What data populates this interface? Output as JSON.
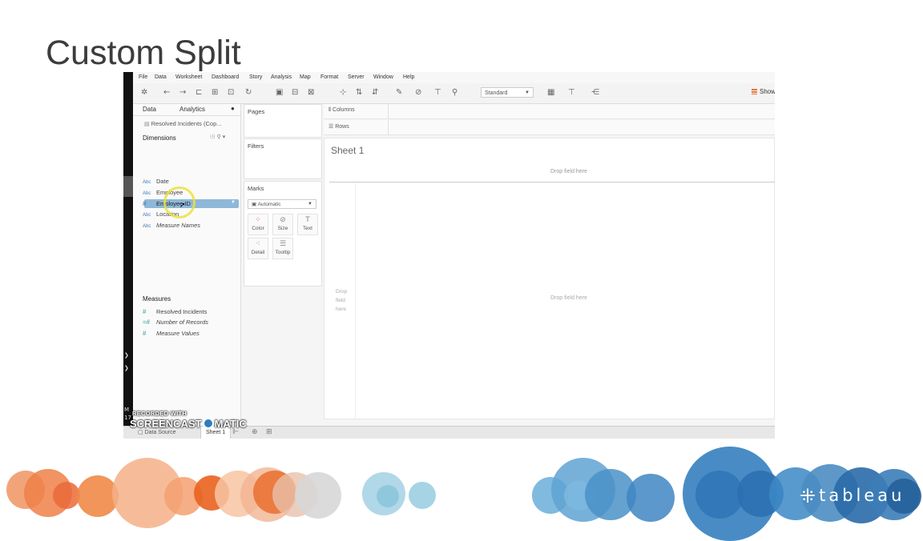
{
  "slide": {
    "title": "Custom Split",
    "logo_text": "tableau",
    "palette": {
      "orange": "#ef7d3c",
      "gray": "#d0d0d0",
      "light_blue": "#9fcfe0",
      "blue": "#2c7fbf"
    }
  },
  "app": {
    "menu": [
      "File",
      "Data",
      "Worksheet",
      "Dashboard",
      "Story",
      "Analysis",
      "Map",
      "Format",
      "Server",
      "Window",
      "Help"
    ],
    "toolbar": {
      "view_size": "Standard",
      "show_me": "Show M"
    },
    "data_pane": {
      "tabs": [
        "Data",
        "Analytics"
      ],
      "datasource": "Resolved Incidents (Cop...",
      "dimensions_header": "Dimensions",
      "dimensions": [
        {
          "type": "Abc",
          "name": "Date"
        },
        {
          "type": "Abc",
          "name": "Employee"
        },
        {
          "type": "#",
          "name": "Employee ID"
        },
        {
          "type": "Abc",
          "name": "Location"
        },
        {
          "type": "Abc",
          "name": "Measure Names"
        }
      ],
      "measures_header": "Measures",
      "measures": [
        {
          "type": "#",
          "name": "Resolved Incidents"
        },
        {
          "type": "=#",
          "name": "Number of Records"
        },
        {
          "type": "#",
          "name": "Measure Values"
        }
      ]
    },
    "shelves": {
      "pages": "Pages",
      "filters": "Filters",
      "marks": "Marks",
      "mark_type": "Automatic",
      "mark_buttons": [
        "Color",
        "Size",
        "Text",
        "Detail",
        "Tooltip"
      ],
      "columns": "Columns",
      "rows": "Rows"
    },
    "view": {
      "sheet_title": "Sheet 1",
      "drop_field_top": "Drop field here",
      "drop_field_left": "Drop field here",
      "drop_field_center": "Drop field here"
    },
    "bottom_tabs": {
      "data_source": "Data Source",
      "sheet": "Sheet 1"
    },
    "left_strip": {
      "time_a": "M",
      "time_b": "17"
    },
    "watermark": {
      "line1": "RECORDED WITH",
      "brand_a": "SCREENCAST",
      "brand_b": "MATIC"
    }
  }
}
